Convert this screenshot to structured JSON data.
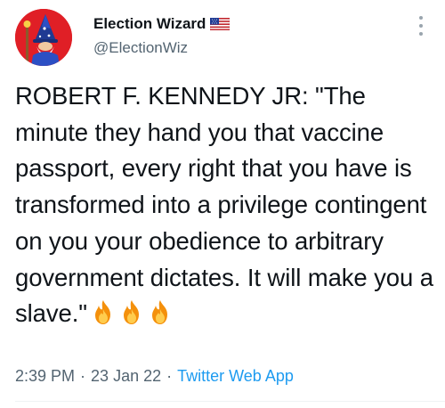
{
  "author": {
    "display_name": "Election Wizard",
    "handle": "@ElectionWiz",
    "flag_icon": "us-flag-icon",
    "avatar_icon": "wizard-avatar-icon",
    "avatar_bg": "#e01f26"
  },
  "tweet": {
    "text": "ROBERT F. KENNEDY JR: \"The minute they hand you that vaccine passport, every right that you have is transformed into a privilege contingent on you your obedience to arbitrary government dictates. It will make you a slave.\"",
    "emoji": [
      "fire-icon",
      "fire-icon",
      "fire-icon"
    ]
  },
  "meta": {
    "time": "2:39 PM",
    "separator": "·",
    "date": "23 Jan 22",
    "source": "Twitter Web App",
    "source_color": "#1d9bf0"
  },
  "menu": {
    "more_icon": "more-vertical-icon"
  }
}
